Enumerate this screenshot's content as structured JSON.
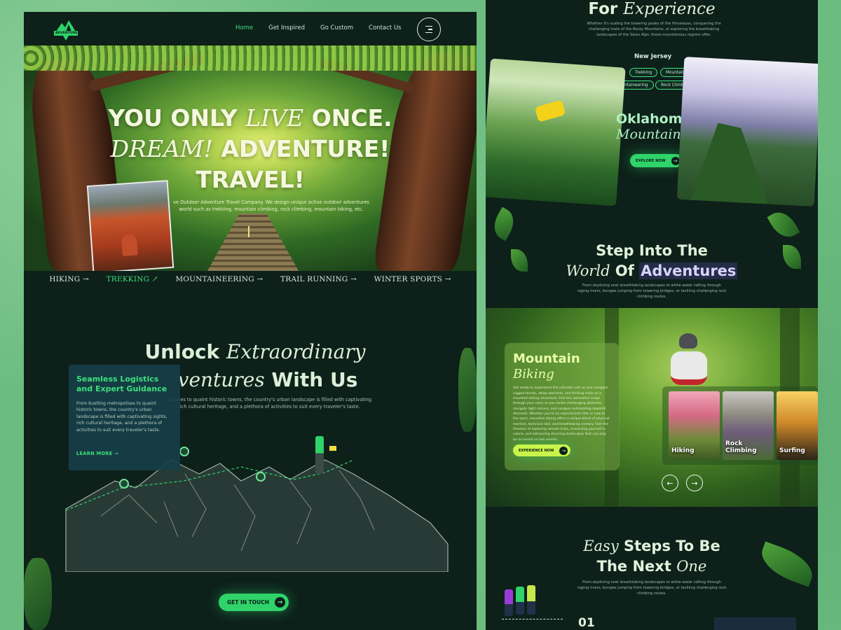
{
  "nav": {
    "logo_text": "ADVENTURE",
    "links": [
      "Home",
      "Get Inspired",
      "Go Custom",
      "Contact Us"
    ],
    "active": "Home"
  },
  "hero": {
    "line1_a": "YOU ONLY ",
    "line1_b": "LIVE",
    "line1_c": " ONCE.",
    "line2_a": "DREAM!",
    "line2_b": " ADVENTURE!",
    "line3": "TRAVEL!",
    "subtitle": "ve Outdoor Adventure Travel Company. We design unique active outdoor adventures world such as trekking, mountain climbing, rock climbing, mountain biking, etc."
  },
  "categories": [
    "HIKING",
    "TREKKING",
    "MOUNTAINEERING",
    "TRAIL RUNNING",
    "WINTER SPORTS"
  ],
  "category_active": "TREKKING",
  "unlock": {
    "line1_a": "Unlock ",
    "line1_b": "Extraordinary",
    "line2_a": "ventures",
    "line2_b": " With Us",
    "subtitle": "opolises to quaint historic towns, the country's urban landscape is filled with captivating rich cultural heritage, and a plethora of activities to suit every traveler's taste."
  },
  "info_card": {
    "title": "Seamless Logistics and Expert Guidance",
    "body": "From bustling metropolises to quaint historic towns, the country's urban landscape is filled with captivating sights, rich cultural heritage, and a plethora of activities to suit every traveler's taste.",
    "link": "LEARN MORE"
  },
  "get_in_touch": "GET IN TOUCH",
  "experience": {
    "title_a": "For ",
    "title_b": "Experience",
    "subtitle": "Whether it's scaling the towering peaks of the Himalayas, conquering the challenging trails of the Rocky Mountains, or exploring the breathtaking landscapes of the Swiss Alps, these mountainous regions offer."
  },
  "location": {
    "region": "New Jersey",
    "tags": [
      "ng",
      "Trekking",
      "Mountain B",
      "Mountaineering",
      "Rock Climbin"
    ],
    "name_a": "Oklahoma",
    "name_b": "Mountain",
    "explore": "EXPLORE NOW"
  },
  "step_into": {
    "line1": "Step Into The",
    "line2_a": "World",
    "line2_b": " Of ",
    "line2_c": "Adventures",
    "subtitle": "From skydiving over breathtaking landscapes to white-water rafting through raging rivers, bungee jumping from towering bridges, or tackling challenging rock climbing routes."
  },
  "biking": {
    "title_a": "Mountain",
    "title_b": "Biking",
    "body": "Get ready to experience the ultimate rush as you navigate rugged terrain, steep descents, and thrilling trails on a mountain biking adventure. Feel the adrenaline surge through your veins as you tackle challenging obstacles, navigate tight corners, and conquer exhilarating downhill descents. Whether you're an experienced rider or new to the sport, mountain biking offers a unique blend of physical exertion, technical skill, and breathtaking scenery. Feel the freedom of exploring remote trails, immersing yourself in nature, and witnessing stunning landscapes that can only be accessed on two wheels.",
    "button": "EXPERIENCE NOW",
    "thumbs": [
      "Hiking",
      "Rock Climbing",
      "Surfing"
    ]
  },
  "easy_steps": {
    "line1_a": "Easy",
    "line1_b": " Steps To Be",
    "line2_a": "The Next ",
    "line2_b": "One",
    "subtitle": "From skydiving over breathtaking landscapes to white-water rafting through raging rivers, bungee jumping from towering bridges, or tackling challenging rock climbing routes.",
    "step_number": "01"
  },
  "colors": {
    "accent": "#3ee07b",
    "panel_bg": "#0d201a",
    "page_bg": "#6cbc80",
    "lime": "#c9f54a"
  }
}
